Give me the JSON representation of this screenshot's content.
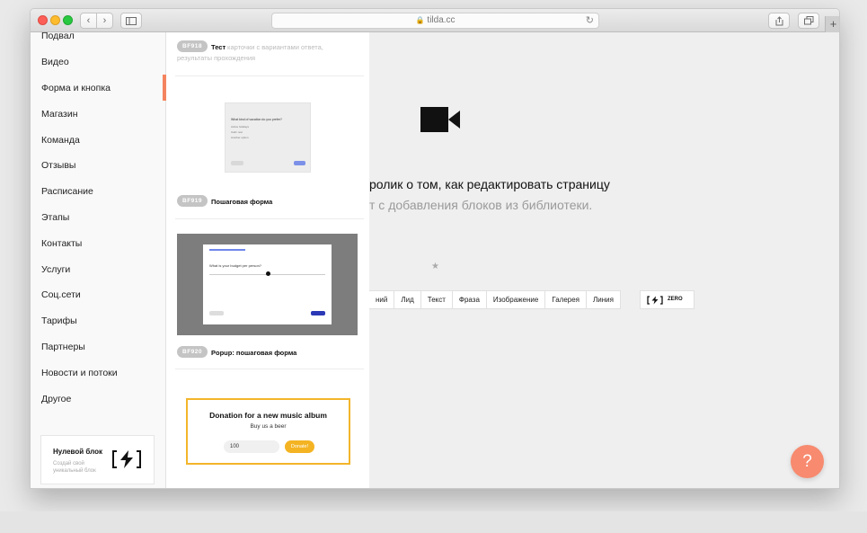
{
  "browser": {
    "url": "tilda.cc",
    "back_icon": "chevron-left-icon",
    "forward_icon": "chevron-right-icon",
    "new_tab_label": "+"
  },
  "categories": {
    "items": [
      {
        "label": "Подвал"
      },
      {
        "label": "Видео"
      },
      {
        "label": "Форма и кнопка"
      },
      {
        "label": "Магазин"
      },
      {
        "label": "Команда"
      },
      {
        "label": "Отзывы"
      },
      {
        "label": "Расписание"
      },
      {
        "label": "Этапы"
      },
      {
        "label": "Контакты"
      },
      {
        "label": "Услуги"
      },
      {
        "label": "Соц.сети"
      },
      {
        "label": "Тарифы"
      },
      {
        "label": "Партнеры"
      },
      {
        "label": "Новости и потоки"
      },
      {
        "label": "Другое"
      }
    ],
    "active": "Форма и кнопка",
    "zero_card": {
      "title": "Нулевой блок",
      "description": "Создай свой уникальный блок"
    }
  },
  "blocks": [
    {
      "code": "BF918",
      "name": "Тест",
      "description": "карточки с вариантами ответа, результаты прохождения"
    },
    {
      "code": "BF919",
      "name": "Пошаговая форма",
      "preview": {
        "question": "What kind of vacation do you prefer?",
        "options": [
          "Active holidays",
          "Calm rest",
          "Another option"
        ]
      }
    },
    {
      "code": "BF920",
      "name": "Popup: пошаговая форма",
      "preview": {
        "question": "What is your budget per person?"
      }
    },
    {
      "code": "",
      "name": "",
      "preview": {
        "title": "Donation for a new music album",
        "subtitle": "Buy us a beer",
        "input_value": "100",
        "button": "Donate!"
      }
    }
  ],
  "main": {
    "headline": "ролик о том, как редактировать страницу",
    "subline": "т с добавления блоков из библиотеки.",
    "tags": [
      "ний",
      "Лид",
      "Текст",
      "Фраза",
      "Изображение",
      "Галерея",
      "Линия"
    ],
    "zero_tag": "ZERO",
    "help_label": "?"
  },
  "colors": {
    "accent": "#f4845f",
    "help_button": "#f78a6f",
    "donation_border": "#f3b52a"
  }
}
